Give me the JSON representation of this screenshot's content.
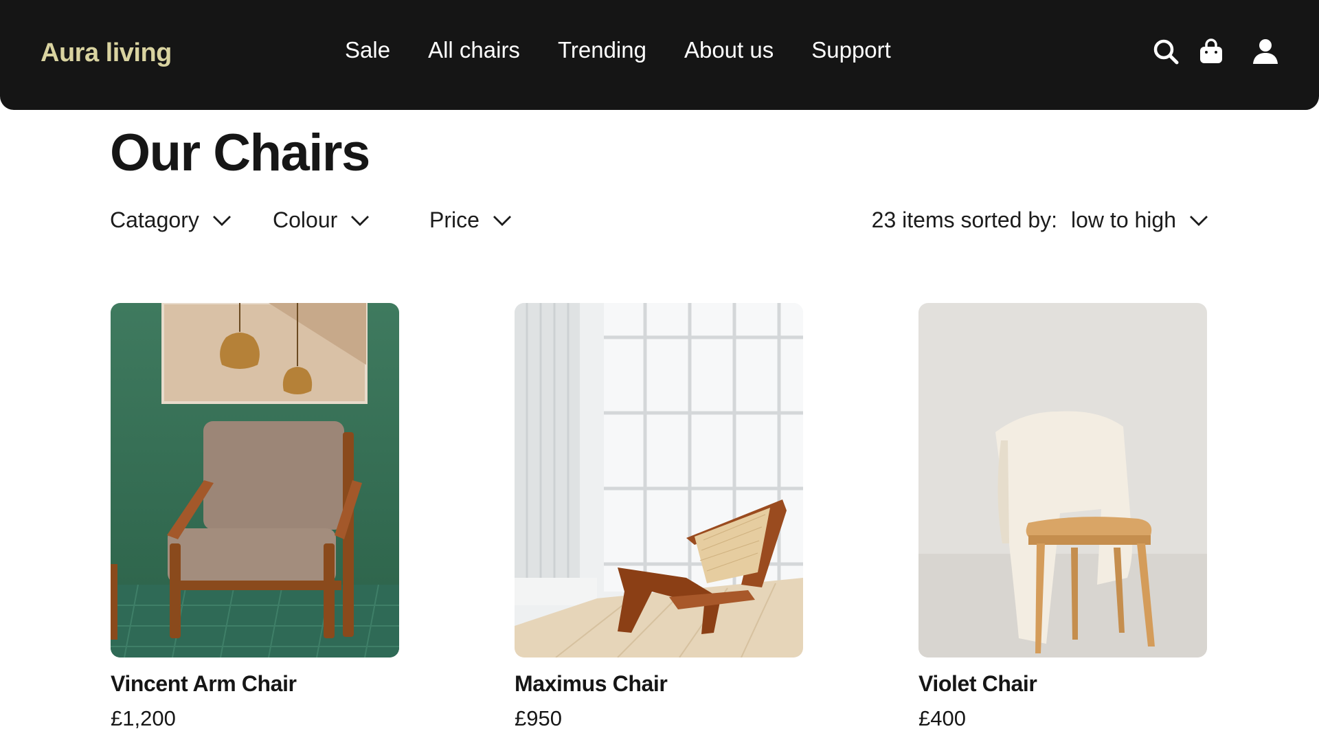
{
  "header": {
    "logo": "Aura living",
    "nav": [
      {
        "label": "Sale"
      },
      {
        "label": "All chairs"
      },
      {
        "label": "Trending"
      },
      {
        "label": "About us"
      },
      {
        "label": "Support"
      }
    ],
    "icons": [
      "search-icon",
      "shopping-bag-icon",
      "user-icon"
    ]
  },
  "main": {
    "title": "Our Chairs",
    "filters": [
      {
        "label": "Catagory",
        "icon": "chevron-down-icon"
      },
      {
        "label": "Colour",
        "icon": "chevron-down-icon"
      },
      {
        "label": "Price",
        "icon": "chevron-down-icon"
      }
    ],
    "sort": {
      "prefix": "23 items sorted by:",
      "value": "low to high",
      "icon": "chevron-down-icon"
    },
    "products": [
      {
        "name": "Vincent Arm Chair",
        "price": "£1,200"
      },
      {
        "name": "Maximus Chair",
        "price": "£950"
      },
      {
        "name": "Violet Chair",
        "price": "£400"
      }
    ]
  },
  "colors": {
    "header_bg": "#151515",
    "logo": "#d9d3a0",
    "text": "#161616",
    "background": "#ffffff"
  }
}
